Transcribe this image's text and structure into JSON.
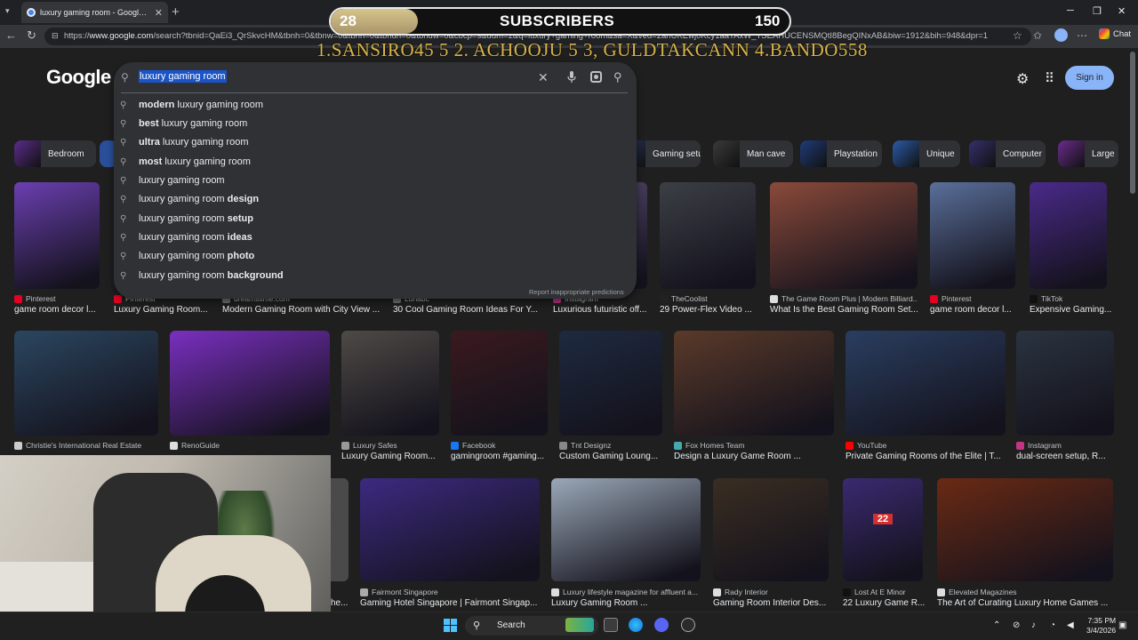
{
  "browser": {
    "tab_title": "luxury gaming room - Google Search",
    "url_prefix": "https://",
    "url_domain": "www.google.com",
    "url_rest": "/search?tbnid=QaEi3_QrSkvcHM&tbnh=0&tbnw=0&tbnn=0&tbndh=0&tbndw=0&cbcp=s&udm=2&q=luxury+gaming+room&sa=X&ved=2ahUKEwj0Kcy1aaTAxW_TSEAHUCENSMQtI8BegQINxAB&biw=1912&bih=948&dpr=1",
    "chat_label": "Chat"
  },
  "overlay": {
    "subs_current": "28",
    "subs_label": "SUBSCRIBERS",
    "subs_goal": "150",
    "subs_progress": 0.19,
    "leaderboard": "1.SANSIRO45 5 2. ACHOOJU 5  3, GULDTAKCANN  4.BANDO558"
  },
  "google": {
    "logo": "Google",
    "query": "luxury gaming room",
    "signin_label": "Sign in",
    "report_text": "Report inappropriate predictions",
    "suggestions": [
      {
        "pre": "modern",
        "base": " luxury gaming room",
        "post": ""
      },
      {
        "pre": "best",
        "base": " luxury gaming room",
        "post": ""
      },
      {
        "pre": "ultra",
        "base": " luxury gaming room",
        "post": ""
      },
      {
        "pre": "most",
        "base": " luxury gaming room",
        "post": ""
      },
      {
        "pre": "",
        "base": "luxury gaming room",
        "post": ""
      },
      {
        "pre": "",
        "base": "luxury gaming room ",
        "post": "design"
      },
      {
        "pre": "",
        "base": "luxury gaming room ",
        "post": "setup"
      },
      {
        "pre": "",
        "base": "luxury gaming room ",
        "post": "ideas"
      },
      {
        "pre": "",
        "base": "luxury gaming room ",
        "post": "photo"
      },
      {
        "pre": "",
        "base": "luxury gaming room ",
        "post": "background"
      }
    ]
  },
  "chips": [
    {
      "label": "Bedroom",
      "color": "#5b2c8c"
    },
    {
      "label": "Gaming setup",
      "color": "#2a3a6a"
    },
    {
      "label": "Man cave",
      "color": "#3a3a3a"
    },
    {
      "label": "Playstation",
      "color": "#1f3c7a"
    },
    {
      "label": "Unique",
      "color": "#2b5aa8"
    },
    {
      "label": "Computer",
      "color": "#34306b"
    },
    {
      "label": "Large",
      "color": "#6a2c8c"
    }
  ],
  "results_row1": [
    {
      "source": "Pinterest",
      "caption": "game room decor l...",
      "color": "#6a3fb0",
      "icon": "#e60023"
    },
    {
      "source": "Pinterest",
      "caption": "Luxury Gaming Room...",
      "color": "#4b2b7a",
      "icon": "#e60023"
    },
    {
      "source": "dreamstime.com",
      "caption": "Modern Gaming Room with City View ...",
      "color": "#3a2f5a",
      "icon": "#777777"
    },
    {
      "source": "Lunabc",
      "caption": "30 Cool Gaming Room Ideas For Y...",
      "color": "#2f3b5a",
      "icon": "#777777"
    },
    {
      "source": "Instagram",
      "caption": "Luxurious futuristic off...",
      "color": "#554a6e",
      "icon": "#c13584"
    },
    {
      "source": "TheCoolist",
      "caption": "29 Power-Flex Video ...",
      "color": "#3c3f46",
      "icon": "#222222"
    },
    {
      "source": "The Game Room Plus | Modern Billiard...",
      "caption": "What Is the Best Gaming Room Set...",
      "color": "#8a4a3a",
      "icon": "#dddddd"
    },
    {
      "source": "Pinterest",
      "caption": "game room decor l...",
      "color": "#5a6f9a",
      "icon": "#e60023"
    },
    {
      "source": "TikTok",
      "caption": "Expensive Gaming...",
      "color": "#4a2a8a",
      "icon": "#111111"
    }
  ],
  "results_row2": [
    {
      "source": "Christie's International Real Estate",
      "caption": "",
      "color": "#2b4660",
      "icon": "#cccccc"
    },
    {
      "source": "RenoGuide",
      "caption": "",
      "color": "#7a2fc0",
      "icon": "#dddddd"
    },
    {
      "source": "Luxury Safes",
      "caption": "Luxury Gaming Room...",
      "color": "#4e4a46",
      "icon": "#999999"
    },
    {
      "source": "Facebook",
      "caption": "gamingroom #gaming...",
      "color": "#3a1a1e",
      "icon": "#1877f2"
    },
    {
      "source": "Tnt Designz",
      "caption": "Custom Gaming Loung...",
      "color": "#1e2a40",
      "icon": "#888888"
    },
    {
      "source": "Fox Homes Team",
      "caption": "Design a Luxury Game Room ...",
      "color": "#5a3a2a",
      "icon": "#4aa"
    },
    {
      "source": "YouTube",
      "caption": "Private Gaming Rooms of the Elite | T...",
      "color": "#2a3e60",
      "icon": "#ff0000"
    },
    {
      "source": "Instagram",
      "caption": "dual-screen setup, R...",
      "color": "#2a3440",
      "icon": "#c13584"
    }
  ],
  "results_row3": [
    {
      "source": "Fairmont Singapore",
      "caption": "Gaming Hotel Singapore | Fairmont Singap...",
      "color": "#3c2a80",
      "icon": "#aaaaaa"
    },
    {
      "source": "Luxury lifestyle magazine for affluent a...",
      "caption": "Luxury Gaming Room ...",
      "color": "#9aa8b8",
      "icon": "#dddddd"
    },
    {
      "source": "Rady Interior",
      "caption": "Gaming Room Interior Des...",
      "color": "#3a2e22",
      "icon": "#dddddd"
    },
    {
      "source": "Lost At E Minor",
      "caption": "22 Luxury Game R...",
      "color": "#3a2a70",
      "icon": "#111111"
    },
    {
      "source": "Elevated Magazines",
      "caption": "The Art of Curating Luxury Home Games ...",
      "color": "#6a2a14",
      "icon": "#dddddd"
    }
  ],
  "partial_row3_caption": "he...",
  "thumb_badge": "22",
  "taskbar": {
    "search_label": "Search",
    "time": "7:35 PM",
    "date": "3/4/2026"
  }
}
